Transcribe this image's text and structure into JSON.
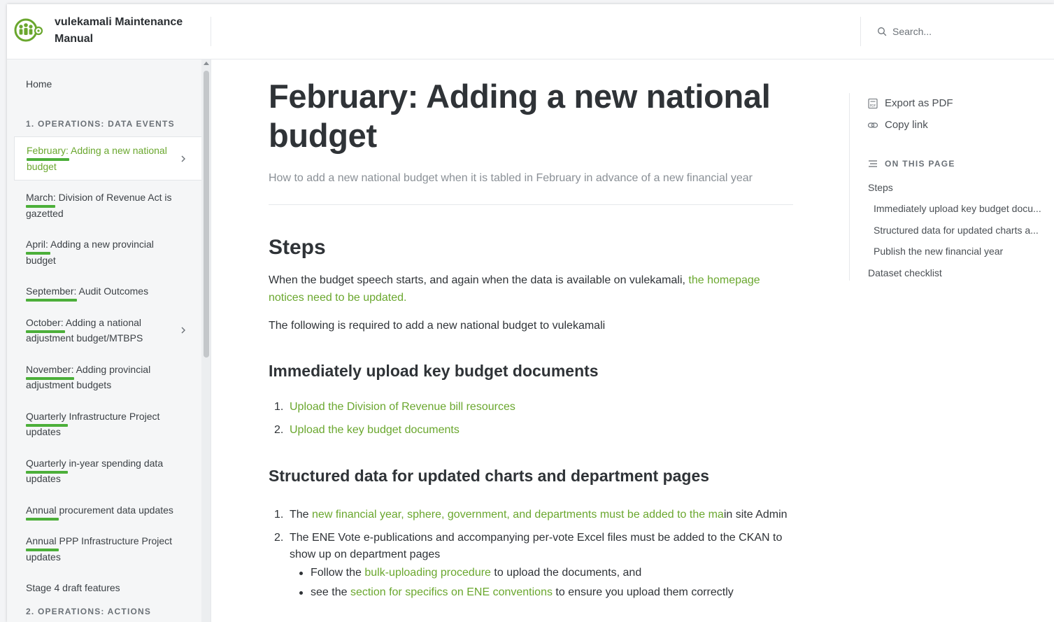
{
  "brand": {
    "title": "vulekamali Maintenance Manual"
  },
  "search": {
    "placeholder": "Search..."
  },
  "sidebar": {
    "home": "Home",
    "section1": "1. OPERATIONS: DATA EVENTS",
    "section2": "2. OPERATIONS: ACTIONS",
    "items": [
      {
        "label": "February: Adding a new national budget",
        "active": true,
        "chevron": true
      },
      {
        "label": "March: Division of Revenue Act is gazetted",
        "active": false,
        "chevron": false
      },
      {
        "label": "April: Adding a new provincial budget",
        "active": false,
        "chevron": false
      },
      {
        "label": "September: Audit Outcomes",
        "active": false,
        "chevron": false
      },
      {
        "label": "October: Adding a national adjustment budget/MTBPS",
        "active": false,
        "chevron": true
      },
      {
        "label": "November: Adding provincial adjustment budgets",
        "active": false,
        "chevron": false
      },
      {
        "label": "Quarterly Infrastructure Project updates",
        "active": false,
        "chevron": false
      },
      {
        "label": "Quarterly in-year spending data updates",
        "active": false,
        "chevron": false
      },
      {
        "label": "Annual procurement data updates",
        "active": false,
        "chevron": false
      },
      {
        "label": "Annual PPP Infrastructure Project updates",
        "active": false,
        "chevron": false
      },
      {
        "label": "Stage 4 draft features",
        "active": false,
        "chevron": false
      }
    ]
  },
  "main": {
    "title": "February: Adding a new national budget",
    "subtitle": "How to add a new national budget when it is tabled in February in advance of a new financial year",
    "steps_heading": "Steps",
    "steps_para_1_pre": "When the budget speech starts, and again when the data is available on vulekamali, ",
    "steps_para_1_link": "the homepage notices need to be updated.",
    "steps_para_2": "The following is required to add a new national budget to vulekamali",
    "section_a": {
      "heading": "Immediately upload key budget documents",
      "items": [
        {
          "num": "1.",
          "text": "Upload the Division of Revenue bill resources"
        },
        {
          "num": "2.",
          "text": "Upload the key budget documents"
        }
      ]
    },
    "section_b": {
      "heading": "Structured data for updated charts and department pages",
      "item1_num": "1.",
      "item1_pre": "The ",
      "item1_link": "new financial year, sphere, government, and departments must be added to the ma",
      "item1_post": "in site Admin",
      "item2_num": "2.",
      "item2_text": "The ENE Vote e-publications and accompanying per-vote Excel files must be added to the CKAN to show up on department pages",
      "bullet1_pre": "Follow the ",
      "bullet1_link": "bulk-uploading procedure",
      "bullet1_post": " to upload the documents, and",
      "bullet2_pre": "see the ",
      "bullet2_link": "section for specifics on ENE conventions",
      "bullet2_post": " to ensure you upload them correctly"
    }
  },
  "toc": {
    "export_label": "Export as PDF",
    "copy_label": "Copy link",
    "heading": "ON THIS PAGE",
    "items": [
      {
        "label": "Steps",
        "level": 1
      },
      {
        "label": "Immediately upload key budget docu...",
        "level": 2
      },
      {
        "label": "Structured data for updated charts a...",
        "level": 2
      },
      {
        "label": "Publish the new financial year",
        "level": 2
      },
      {
        "label": "Dataset checklist",
        "level": 1
      }
    ]
  },
  "colors": {
    "accent": "#6aa72e",
    "underline": "#4caf3a",
    "text": "#2f3337",
    "muted": "#8a9096"
  }
}
